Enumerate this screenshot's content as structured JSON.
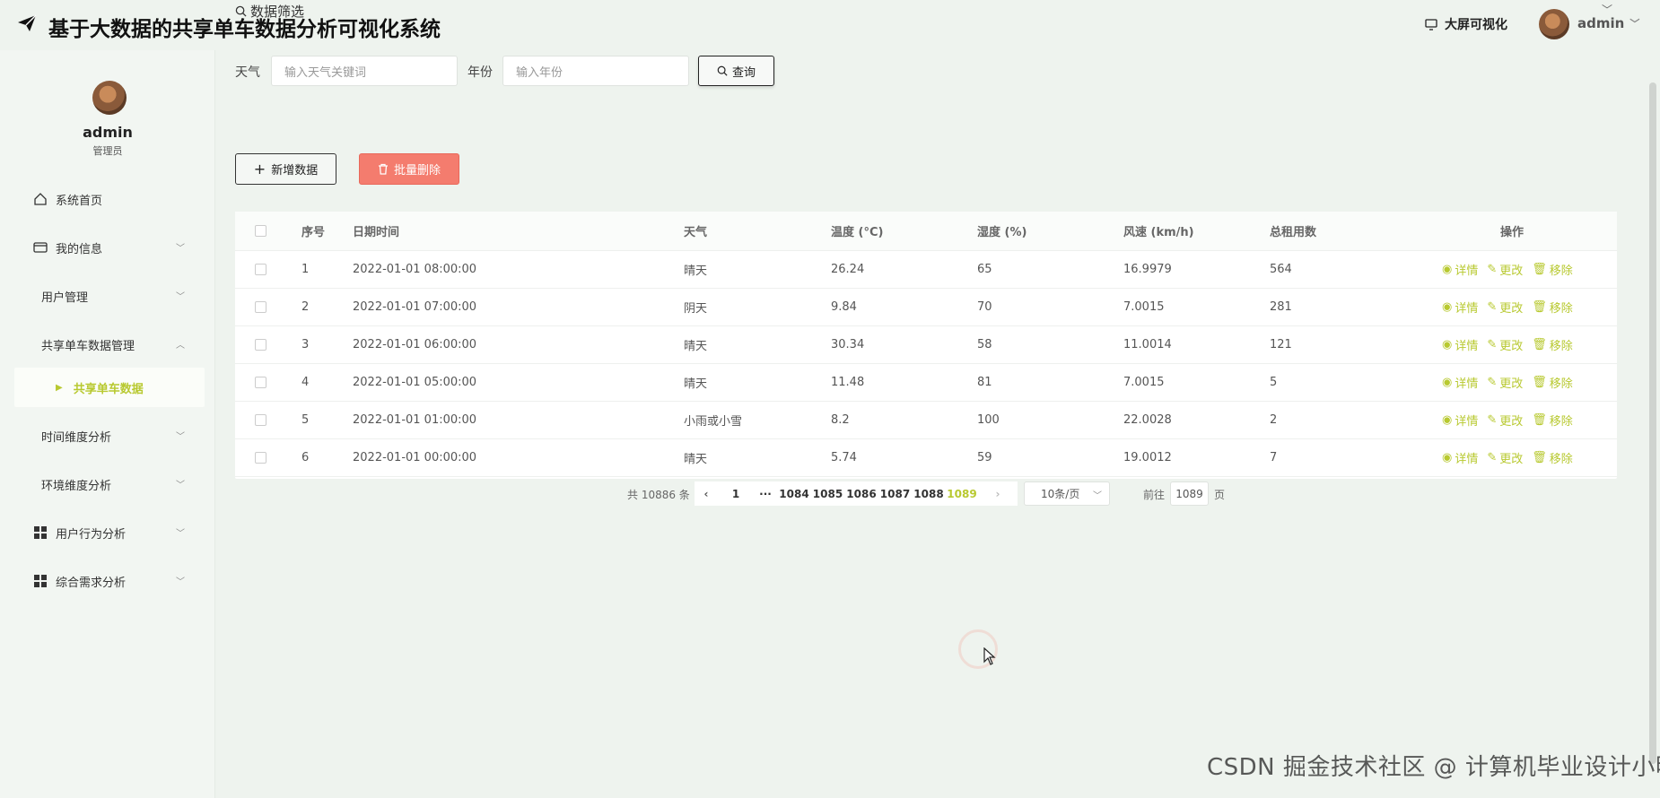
{
  "header": {
    "title": "基于大数据的共享单车数据分析可视化系统",
    "filter_label": "数据筛选",
    "bigscreen_label": "大屏可视化",
    "username": "admin"
  },
  "sidebar": {
    "user_name": "admin",
    "user_role": "管理员",
    "items": [
      {
        "label": "系统首页"
      },
      {
        "label": "我的信息"
      },
      {
        "label": "用户管理"
      },
      {
        "label": "共享单车数据管理"
      },
      {
        "label": "共享单车数据"
      },
      {
        "label": "时间维度分析"
      },
      {
        "label": "环境维度分析"
      },
      {
        "label": "用户行为分析"
      },
      {
        "label": "综合需求分析"
      }
    ]
  },
  "search": {
    "weather_label": "天气",
    "weather_placeholder": "输入天气关键词",
    "year_label": "年份",
    "year_placeholder": "输入年份",
    "query_label": "查询"
  },
  "actions": {
    "add_label": "新增数据",
    "batch_delete_label": "批量删除"
  },
  "table": {
    "columns": [
      "序号",
      "日期时间",
      "天气",
      "温度 (°C)",
      "湿度 (%)",
      "风速 (km/h)",
      "总租用数",
      "操作"
    ],
    "op_labels": {
      "detail": "详情",
      "edit": "更改",
      "remove": "移除"
    },
    "rows": [
      {
        "idx": "1",
        "datetime": "2022-01-01 08:00:00",
        "weather": "晴天",
        "temp": "26.24",
        "humidity": "65",
        "wind": "16.9979",
        "rentals": "564"
      },
      {
        "idx": "2",
        "datetime": "2022-01-01 07:00:00",
        "weather": "阴天",
        "temp": "9.84",
        "humidity": "70",
        "wind": "7.0015",
        "rentals": "281"
      },
      {
        "idx": "3",
        "datetime": "2022-01-01 06:00:00",
        "weather": "晴天",
        "temp": "30.34",
        "humidity": "58",
        "wind": "11.0014",
        "rentals": "121"
      },
      {
        "idx": "4",
        "datetime": "2022-01-01 05:00:00",
        "weather": "晴天",
        "temp": "11.48",
        "humidity": "81",
        "wind": "7.0015",
        "rentals": "5"
      },
      {
        "idx": "5",
        "datetime": "2022-01-01 01:00:00",
        "weather": "小雨或小雪",
        "temp": "8.2",
        "humidity": "100",
        "wind": "22.0028",
        "rentals": "2"
      },
      {
        "idx": "6",
        "datetime": "2022-01-01 00:00:00",
        "weather": "晴天",
        "temp": "5.74",
        "humidity": "59",
        "wind": "19.0012",
        "rentals": "7"
      }
    ]
  },
  "pagination": {
    "total": "共 10886 条",
    "first": "1",
    "ellipsis": "···",
    "pages": [
      "1084",
      "1085",
      "1086",
      "1087",
      "1088",
      "1089"
    ],
    "current": "1089",
    "page_size": "10条/页",
    "goto_label": "前往",
    "goto_value": "1089",
    "page_suffix": "页"
  },
  "watermark": "CSDN 掘金技术社区 @ 计算机毕业设计小明哥",
  "colors": {
    "accent": "#b8c930",
    "danger": "#f47c6e"
  }
}
